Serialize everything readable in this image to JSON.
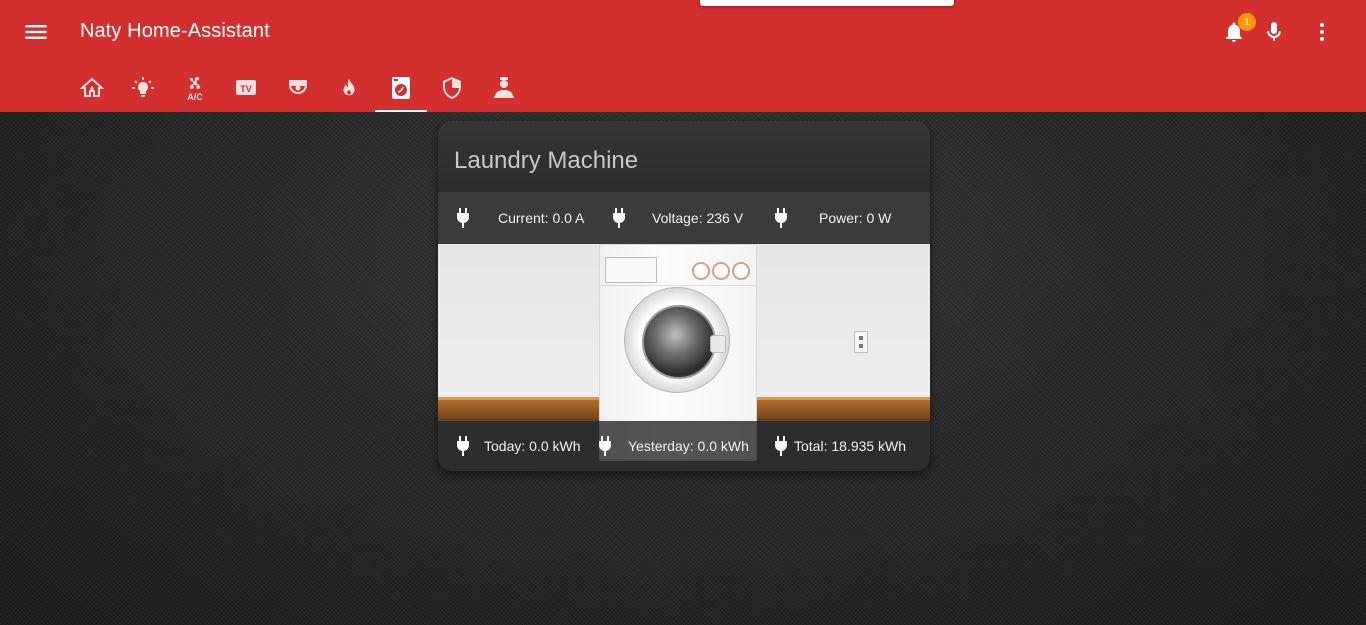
{
  "app": {
    "title": "Naty Home-Assistant",
    "notification_count": "1"
  },
  "header": {
    "icons": [
      "menu-icon",
      "bell-icon",
      "microphone-icon",
      "more-vert-icon"
    ]
  },
  "tabs": [
    {
      "name": "home-icon",
      "active": false
    },
    {
      "name": "lightbulb-icon",
      "active": false
    },
    {
      "name": "air-conditioner-icon",
      "active": false
    },
    {
      "name": "tv-icon",
      "active": false
    },
    {
      "name": "camera-dome-icon",
      "active": false
    },
    {
      "name": "fire-icon",
      "active": false
    },
    {
      "name": "washing-machine-icon",
      "active": true
    },
    {
      "name": "security-shield-icon",
      "active": false
    },
    {
      "name": "account-icon",
      "active": false
    }
  ],
  "card": {
    "title": "Laundry Machine",
    "top_row": {
      "current": "Current: 0.0 A",
      "voltage": "Voltage: 236 V",
      "power": "Power: 0 W"
    },
    "bottom_row": {
      "today": "Today: 0.0 kWh",
      "yesterday": "Yesterday: 0.0 kWh",
      "total": "Total: 18.935 kWh"
    }
  },
  "colors": {
    "header_bg": "#d32f2f",
    "badge": "#ff9800",
    "page_bg": "#262626"
  }
}
